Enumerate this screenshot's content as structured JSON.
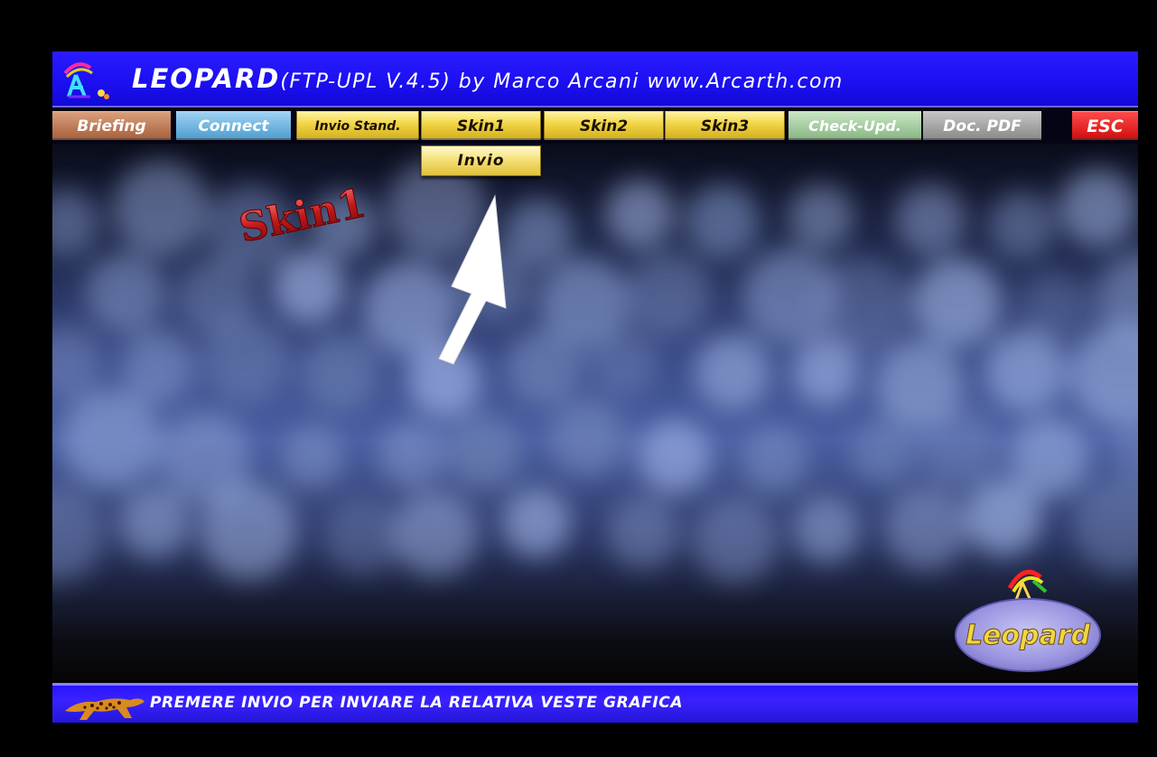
{
  "title": {
    "main": "LEOPARD",
    "rest": "(FTP-UPL V.4.5) by Marco Arcani www.Arcarth.com"
  },
  "menu": {
    "briefing": "Briefing",
    "connect": "Connect",
    "invio_stand": "Invio Stand.",
    "skin1": "Skin1",
    "skin2": "Skin2",
    "skin3": "Skin3",
    "check_upd": "Check-Upd.",
    "doc_pdf": "Doc. PDF",
    "esc": "ESC"
  },
  "dropdown": {
    "invio": "Invio"
  },
  "main": {
    "skin_label": "Skin1",
    "logo_text": "Leopard"
  },
  "status": {
    "text": "PREMERE INVIO PER INVIARE LA RELATIVA VESTE GRAFICA"
  },
  "colors": {
    "title_bar": "#1c10f2",
    "menu_gold": "#f0d545",
    "esc_red": "#d11010",
    "status_bar": "#2814ff"
  }
}
